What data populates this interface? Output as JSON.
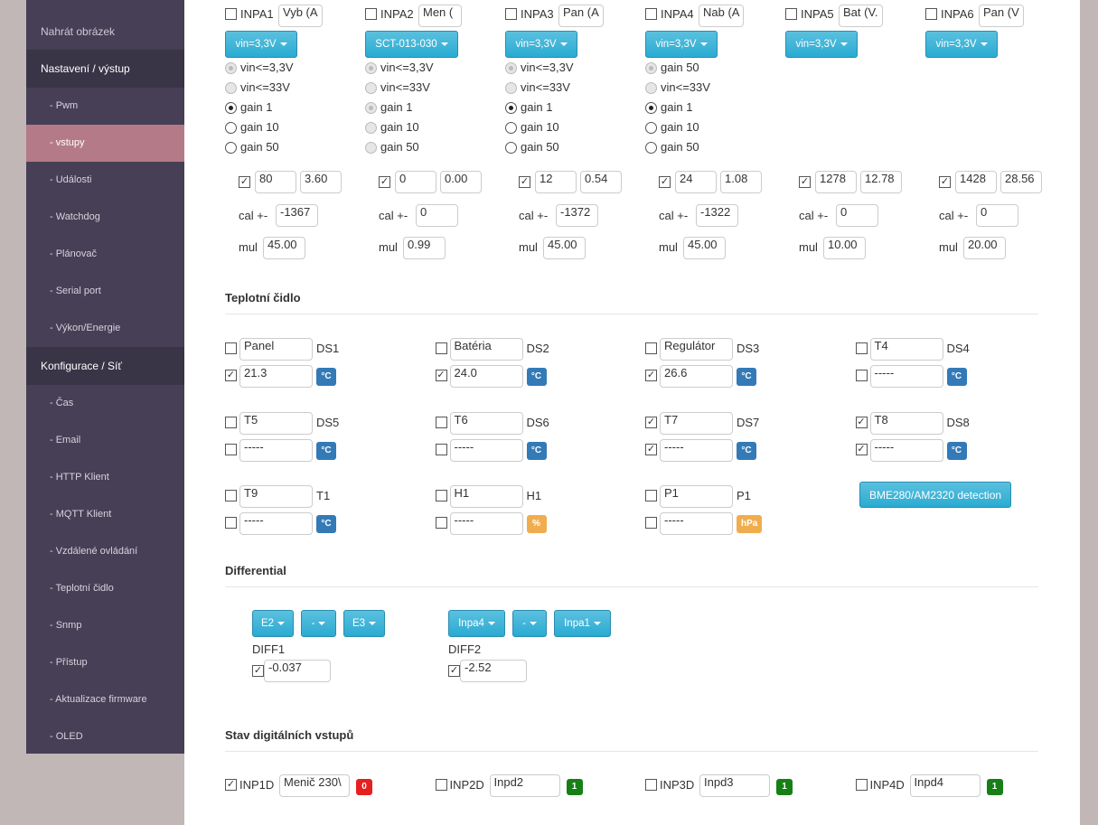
{
  "sidebar": {
    "items": [
      {
        "label": "Nahrát obrázek",
        "type": "top"
      },
      {
        "label": "Nastavení / výstup",
        "type": "header"
      },
      {
        "label": "- Pwm"
      },
      {
        "label": "- vstupy",
        "active": true
      },
      {
        "label": "- Události"
      },
      {
        "label": "- Watchdog"
      },
      {
        "label": "- Plánovač"
      },
      {
        "label": "- Serial port"
      },
      {
        "label": "- Výkon/Energie"
      },
      {
        "label": "Konfigurace / Síť",
        "type": "header"
      },
      {
        "label": "- Čas"
      },
      {
        "label": "- Email"
      },
      {
        "label": "- HTTP Klient"
      },
      {
        "label": "- MQTT Klient"
      },
      {
        "label": "- Vzdálené ovládání"
      },
      {
        "label": "- Teplotní čidlo"
      },
      {
        "label": "- Snmp"
      },
      {
        "label": "- Přístup"
      },
      {
        "label": "- Aktualizace firmware"
      },
      {
        "label": "- OLED"
      }
    ]
  },
  "analog": [
    {
      "name": "INPA1",
      "label": "Vyb (A",
      "enabled": false,
      "mode": "vin=3,3V",
      "radios": [
        {
          "label": "vin<=3,3V",
          "on": true,
          "dis": true
        },
        {
          "label": "vin<=33V",
          "dis": true
        },
        {
          "label": "gain 1",
          "on": true
        },
        {
          "label": "gain 10"
        },
        {
          "label": "gain 50"
        }
      ],
      "checked": true,
      "raw": "80",
      "value": "3.60",
      "cal": "-1367",
      "mul": "45.00"
    },
    {
      "name": "INPA2",
      "label": "Men (",
      "enabled": false,
      "mode": "SCT-013-030",
      "radios": [
        {
          "label": "vin<=3,3V",
          "on": true,
          "dis": true
        },
        {
          "label": "vin<=33V",
          "dis": true
        },
        {
          "label": "gain 1",
          "on": true,
          "dis": true
        },
        {
          "label": "gain 10",
          "dis": true
        },
        {
          "label": "gain 50",
          "dis": true
        }
      ],
      "checked": true,
      "raw": "0",
      "value": "0.00",
      "cal": "0",
      "mul": "0.99"
    },
    {
      "name": "INPA3",
      "label": "Pan (A",
      "enabled": false,
      "mode": "vin=3,3V",
      "radios": [
        {
          "label": "vin<=3,3V",
          "on": true,
          "dis": true
        },
        {
          "label": "vin<=33V",
          "dis": true
        },
        {
          "label": "gain 1",
          "on": true
        },
        {
          "label": "gain 10"
        },
        {
          "label": "gain 50"
        }
      ],
      "checked": true,
      "raw": "12",
      "value": "0.54",
      "cal": "-1372",
      "mul": "45.00"
    },
    {
      "name": "INPA4",
      "label": "Nab (A",
      "enabled": false,
      "mode": "vin=3,3V",
      "radios": [
        {
          "label": "gain 50",
          "on": true,
          "dis": true
        },
        {
          "label": "vin<=33V",
          "dis": true
        },
        {
          "label": "gain 1",
          "on": true
        },
        {
          "label": "gain 10"
        },
        {
          "label": "gain 50"
        }
      ],
      "checked": true,
      "raw": "24",
      "value": "1.08",
      "cal": "-1322",
      "mul": "45.00"
    },
    {
      "name": "INPA5",
      "label": "Bat (V.",
      "enabled": false,
      "mode": "vin=3,3V",
      "radios": [],
      "checked": true,
      "raw": "1278",
      "value": "12.78",
      "cal": "0",
      "mul": "10.00"
    },
    {
      "name": "INPA6",
      "label": "Pan (V",
      "enabled": false,
      "mode": "vin=3,3V",
      "radios": [],
      "checked": true,
      "raw": "1428",
      "value": "28.56",
      "cal": "0",
      "mul": "20.00"
    }
  ],
  "labels": {
    "cal": "cal +-",
    "mul": "mul"
  },
  "temp": {
    "title": "Teplotní čidlo",
    "detect_button": "BME280/AM2320 detection",
    "sensors": [
      {
        "name": "Panel",
        "id": "DS1",
        "en": false,
        "vchk": true,
        "value": "21.3",
        "unit": "°C",
        "color": "#337ab7"
      },
      {
        "name": "Batéria",
        "id": "DS2",
        "en": false,
        "vchk": true,
        "value": "24.0",
        "unit": "°C",
        "color": "#337ab7"
      },
      {
        "name": "Regulátor",
        "id": "DS3",
        "en": false,
        "vchk": true,
        "value": "26.6",
        "unit": "°C",
        "color": "#337ab7"
      },
      {
        "name": "T4",
        "id": "DS4",
        "en": false,
        "vchk": false,
        "value": "-----",
        "unit": "°C",
        "color": "#337ab7"
      },
      {
        "name": "T5",
        "id": "DS5",
        "en": false,
        "vchk": false,
        "value": "-----",
        "unit": "°C",
        "color": "#337ab7"
      },
      {
        "name": "T6",
        "id": "DS6",
        "en": false,
        "vchk": false,
        "value": "-----",
        "unit": "°C",
        "color": "#337ab7"
      },
      {
        "name": "T7",
        "id": "DS7",
        "en": true,
        "vchk": true,
        "value": "-----",
        "unit": "°C",
        "color": "#337ab7"
      },
      {
        "name": "T8",
        "id": "DS8",
        "en": true,
        "vchk": true,
        "value": "-----",
        "unit": "°C",
        "color": "#337ab7"
      },
      {
        "name": "T9",
        "id": "T1",
        "en": false,
        "vchk": false,
        "value": "-----",
        "unit": "°C",
        "color": "#337ab7"
      },
      {
        "name": "H1",
        "id": "H1",
        "en": false,
        "vchk": false,
        "value": "-----",
        "unit": "%",
        "color": "#f0ad4e"
      },
      {
        "name": "P1",
        "id": "P1",
        "en": false,
        "vchk": false,
        "value": "-----",
        "unit": "hPa",
        "color": "#f0ad4e"
      }
    ]
  },
  "diff": {
    "title": "Differential",
    "items": [
      {
        "label": "DIFF1",
        "a": "E2",
        "op": "-",
        "b": "E3",
        "checked": true,
        "value": "-0.037"
      },
      {
        "label": "DIFF2",
        "a": "Inpa4",
        "op": "-",
        "b": "Inpa1",
        "checked": true,
        "value": "-2.52"
      }
    ]
  },
  "digital": {
    "title": "Stav digitálních vstupů",
    "items": [
      {
        "name": "INP1D",
        "label": "Menič 230\\",
        "checked": true,
        "state": "0",
        "color": "#e62020"
      },
      {
        "name": "INP2D",
        "label": "Inpd2",
        "checked": false,
        "state": "1",
        "color": "#168016"
      },
      {
        "name": "INP3D",
        "label": "Inpd3",
        "checked": false,
        "state": "1",
        "color": "#168016"
      },
      {
        "name": "INP4D",
        "label": "Inpd4",
        "checked": false,
        "state": "1",
        "color": "#168016"
      }
    ]
  }
}
